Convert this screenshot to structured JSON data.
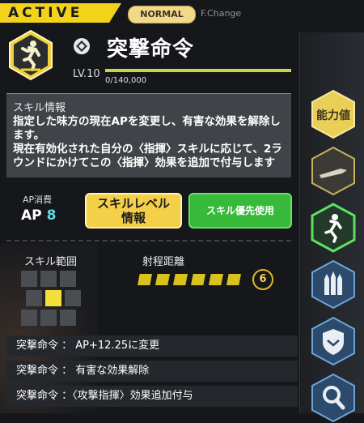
{
  "tabs": {
    "active": "ACTIVE",
    "normal": "NORMAL",
    "fchange": "F.Change"
  },
  "skill": {
    "title": "突撃命令",
    "level": "LV.10",
    "exp": "0/140,000",
    "info_title": "スキル情報",
    "info_body": "指定した味方の現在APを変更し、有害な効果を解除します。\n現在有効化された自分の〈指揮〉スキルに応じて、2ラウンドにかけてこの〈指揮〉効果を追加で付与します",
    "ap_label": "AP消費",
    "ap_key": "AP",
    "ap_value": "8"
  },
  "buttons": {
    "level_info": "スキルレベル情報",
    "priority": "スキル優先使用"
  },
  "range": {
    "label": "スキル範囲",
    "grid": [
      [
        0,
        0,
        0
      ],
      [
        0,
        1,
        0
      ],
      [
        0,
        0,
        0
      ]
    ]
  },
  "distance": {
    "label": "射程距離",
    "segments": 6,
    "value": "6"
  },
  "effects": [
    "突撃命令 ： AP+12.25に変更",
    "突撃命令 ： 有害な効果解除",
    "突撃命令 ：〈攻撃指揮〉効果追加付与"
  ],
  "sidebar": {
    "stats_label": "能力値",
    "icons": [
      "bullet-icon",
      "running-person-icon",
      "rockets-icon",
      "shield-icon",
      "magnifier-icon"
    ]
  },
  "colors": {
    "accent_yellow": "#f2d21a",
    "green": "#37b93a",
    "cyan": "#5fd9e6"
  }
}
